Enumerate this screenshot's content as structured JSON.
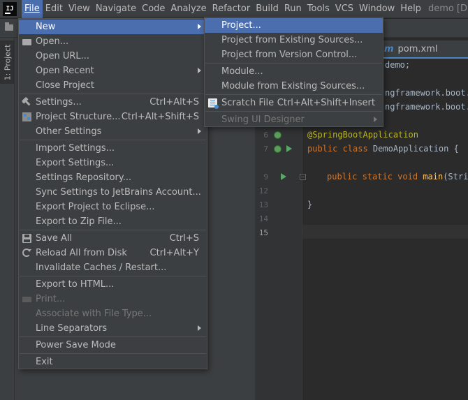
{
  "menubar": {
    "logo": "IJ",
    "items": [
      "File",
      "Edit",
      "View",
      "Navigate",
      "Code",
      "Analyze",
      "Refactor",
      "Build",
      "Run",
      "Tools",
      "VCS",
      "Window",
      "Help"
    ],
    "title": "demo [D"
  },
  "sidebar": {
    "project_tab": "1: Project"
  },
  "editor": {
    "tab_icon": "m",
    "tab_label": "pom.xml",
    "lines": {
      "l1": "demo;",
      "l2": "ngframework.boot.S",
      "l3": "ngframework.boot.a",
      "l6": "@SpringBootApplication",
      "l7_kw": "public class ",
      "l7_name": "DemoApplication {",
      "l9_kw": "public static void ",
      "l9_name": "main",
      "l9_rest": "(Strin",
      "l13": "}"
    },
    "line_numbers": [
      "6",
      "7",
      "9",
      "12",
      "13",
      "14",
      "15"
    ]
  },
  "file_menu": {
    "items": [
      {
        "label": "New",
        "shortcut": "",
        "submenu": true
      },
      {
        "label": "Open...",
        "shortcut": ""
      },
      {
        "label": "Open URL...",
        "shortcut": ""
      },
      {
        "label": "Open Recent",
        "shortcut": "",
        "submenu": true
      },
      {
        "label": "Close Project",
        "shortcut": ""
      },
      {
        "label": "Settings...",
        "shortcut": "Ctrl+Alt+S"
      },
      {
        "label": "Project Structure...",
        "shortcut": "Ctrl+Alt+Shift+S"
      },
      {
        "label": "Other Settings",
        "shortcut": "",
        "submenu": true
      },
      {
        "label": "Import Settings...",
        "shortcut": ""
      },
      {
        "label": "Export Settings...",
        "shortcut": ""
      },
      {
        "label": "Settings Repository...",
        "shortcut": ""
      },
      {
        "label": "Sync Settings to JetBrains Account...",
        "shortcut": ""
      },
      {
        "label": "Export Project to Eclipse...",
        "shortcut": ""
      },
      {
        "label": "Export to Zip File...",
        "shortcut": ""
      },
      {
        "label": "Save All",
        "shortcut": "Ctrl+S"
      },
      {
        "label": "Reload All from Disk",
        "shortcut": "Ctrl+Alt+Y"
      },
      {
        "label": "Invalidate Caches / Restart...",
        "shortcut": ""
      },
      {
        "label": "Export to HTML...",
        "shortcut": ""
      },
      {
        "label": "Print...",
        "shortcut": "",
        "disabled": true
      },
      {
        "label": "Associate with File Type...",
        "shortcut": "",
        "disabled": true
      },
      {
        "label": "Line Separators",
        "shortcut": "",
        "submenu": true
      },
      {
        "label": "Power Save Mode",
        "shortcut": ""
      },
      {
        "label": "Exit",
        "shortcut": ""
      }
    ]
  },
  "new_menu": {
    "items": [
      {
        "label": "Project...",
        "shortcut": ""
      },
      {
        "label": "Project from Existing Sources...",
        "shortcut": ""
      },
      {
        "label": "Project from Version Control...",
        "shortcut": ""
      },
      {
        "label": "Module...",
        "shortcut": ""
      },
      {
        "label": "Module from Existing Sources...",
        "shortcut": ""
      },
      {
        "label": "Scratch File",
        "shortcut": "Ctrl+Alt+Shift+Insert"
      },
      {
        "label": "Swing UI Designer",
        "shortcut": "",
        "submenu": true,
        "disabled": true
      }
    ]
  },
  "colors": {
    "accent": "#4b6eaf",
    "menu_bg": "#3c3f41",
    "editor_bg": "#2b2b2b",
    "annotation": "#bbb529",
    "keyword": "#cc7832"
  }
}
